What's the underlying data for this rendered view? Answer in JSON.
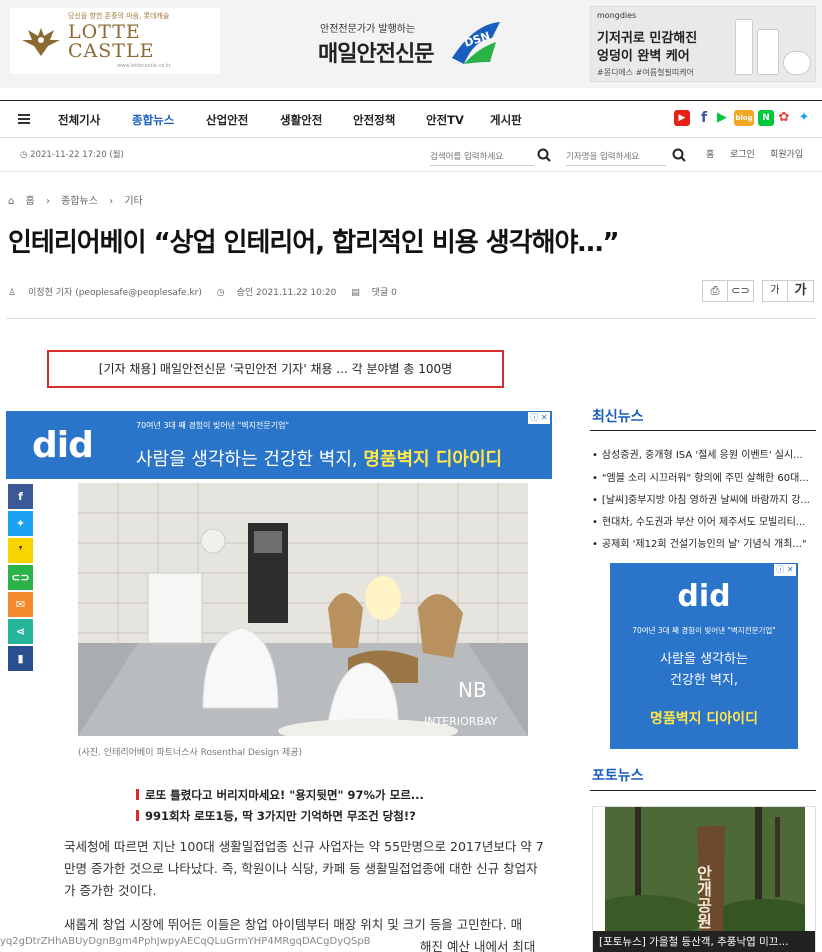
{
  "ads": {
    "lotte": {
      "tagline": "당신을 향한 존중의 마음, 롯데캐슬",
      "name": "LOTTE CASTLE",
      "url": "www.lottecastle.co.kr"
    },
    "mondies": {
      "brand": "mongdies",
      "line1": "기저귀로 민감해진",
      "line2": "엉덩이 완벽 케어",
      "tags": "#몽디에스 #여름철필띠케어"
    }
  },
  "site": {
    "tagline": "안전전문가가 발행하는",
    "name": "매일안전신문",
    "mark": "DSN"
  },
  "nav": {
    "items": [
      {
        "label": "전체기사"
      },
      {
        "label": "종합뉴스"
      },
      {
        "label": "산업안전"
      },
      {
        "label": "생활안전"
      },
      {
        "label": "안전정책"
      },
      {
        "label": "안전TV"
      },
      {
        "label": "게시판"
      }
    ],
    "active_index": 1
  },
  "subbar": {
    "datetime": "2021-11-22 17:20 (월)",
    "search_placeholder": "검색어를 입력하세요",
    "reporter_placeholder": "기자명을 입력하세요",
    "links": [
      "홈",
      "로그인",
      "회원가입"
    ]
  },
  "breadcrumb": {
    "home": "홈",
    "section": "종합뉴스",
    "sub": "기타"
  },
  "article": {
    "title": "인테리어베이 “상업 인테리어, 합리적인 비용 생각해야…”",
    "author": "이정현 기자 (peoplesafe@peoplesafe.kr)",
    "approved": "승인 2021.11.22 10:20",
    "comments": "댓글 0",
    "font_small": "가",
    "font_large": "가",
    "notice": "[기자 채용] 매일안전신문 '국민안전 기자' 채용 ... 각 분야별 총 100명",
    "photo_caption": "(사진. 인테리어베이 파트너스사 Rosenthal Design 제공)",
    "photo_watermark": "INTERIORBAY",
    "related": [
      "로또 틀렸다고 버리지마세요! \"용지뒷면\" 97%가 모르...",
      "991회차 로또1등, 딱 3가지만 기억하면 무조건 당첨!?"
    ],
    "para1": "국세청에 따르면 지난 100대 생활밀접업종 신규 사업자는 약 55만명으로 2017년보다 약 7만명 증가한 것으로 나타났다. 즉, 학원이나 식당, 카페 등 생활밀접업종에 대한 신규 창업자가 증가한 것이다.",
    "para2": "새롭게 창업 시장에 뛰어든 이들은 창업 아이템부터 매장 위치 및 크기 등을 고민한다. 매",
    "para2_tail": "해진 예산 내에서 최대"
  },
  "inline_ad": {
    "brand": "did",
    "line1": "70여년 3대 째 경험이 빚어낸 \"벽지전문기업\"",
    "line2a": "사람을 생각하는 건강한 벽지, ",
    "line2b": "명품벽지 디아이디"
  },
  "share_buttons": [
    "f",
    "t",
    "k",
    "link",
    "mail",
    "share",
    "bookmark"
  ],
  "sidebar": {
    "latest_title": "최신뉴스",
    "latest": [
      "삼성증권, 중개형 ISA '절세 응원 이벤트' 실시...",
      "\"엠블 소리 시끄러워\" 항의에 주민 살해한 60대...",
      "[날씨]중부지방 아침 영하권 날씨에 바람까지 강...",
      "현대차, 수도권과 부산 이어 제주서도 모빌리티...",
      "공제회 '제12회 건설기능인의 날' 기념식 개최...\""
    ],
    "ad": {
      "brand": "did",
      "line1": "70여년 3대 째 경험이 빚어낸 \"벽지전문기업\"",
      "line2": "사람을 생각하는",
      "line3": "건강한 벽지,",
      "line4": "명품벽지 디아이디"
    },
    "photo_title": "포토뉴스",
    "photo_caption": "[포토뉴스] 가을철 등산객, 추풍낙엽 미끄...",
    "photo_sign": "안개공원"
  },
  "status_url": "yq2gDtrZHhABUyDgnBgm4PphJwpyAECqQLuGrmYHP4MRgqDACgDyQSpB",
  "colors": {
    "accent": "#1b5ec0",
    "notice_border": "#d92b2b",
    "ad_blue": "#2a74c9",
    "ad_yellow": "#ffe64a"
  }
}
